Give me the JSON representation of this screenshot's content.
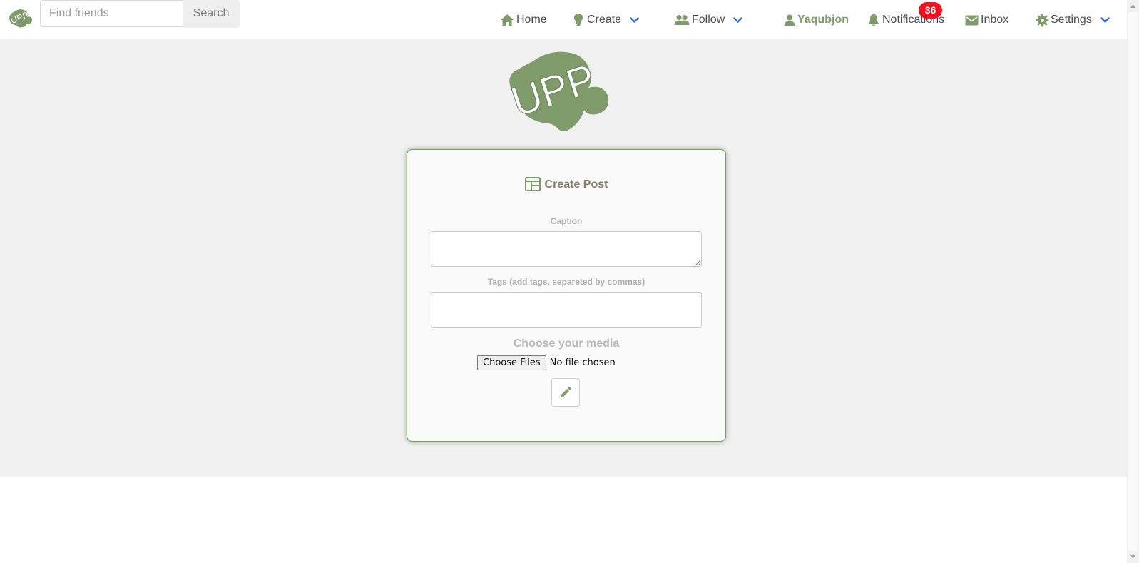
{
  "header": {
    "search": {
      "placeholder": "Find friends",
      "value": "",
      "button_label": "Search"
    },
    "nav": {
      "home": "Home",
      "create": "Create",
      "follow": "Follow",
      "user": "Yaqubjon",
      "notifications": "Notifications",
      "notifications_count": "36",
      "inbox": "Inbox",
      "settings": "Settings"
    }
  },
  "logo": {
    "text": "UPP"
  },
  "form": {
    "title": "Create Post",
    "caption_label": "Caption",
    "caption_value": "",
    "tags_label": "Tags (add tags, separeted by commas)",
    "tags_value": "",
    "media_label": "Choose your media",
    "file_button": "Choose Files",
    "file_status": "No file chosen"
  },
  "colors": {
    "brand_green": "#7f9a6b",
    "page_bg": "#f0f0f0",
    "badge_red": "#e8141f",
    "chevron_blue": "#3a6fd8"
  }
}
